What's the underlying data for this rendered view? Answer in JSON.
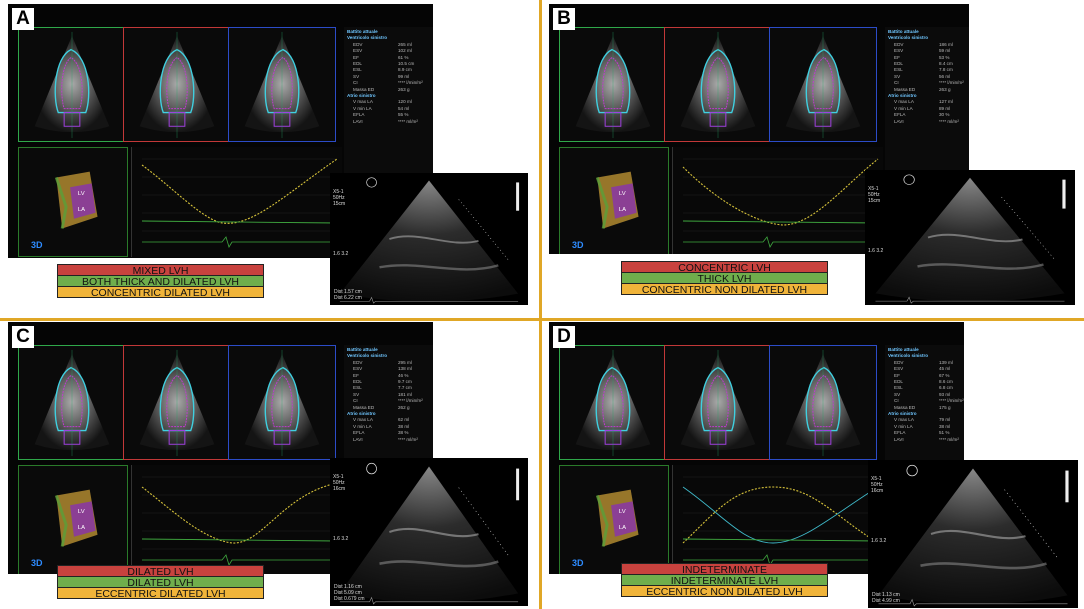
{
  "colors": {
    "divider": "#e0a726",
    "red_label": "#c8423e",
    "green_label": "#6fae4c",
    "yellow_label": "#f0b43a"
  },
  "panels": [
    {
      "letter": "A",
      "labels": [
        "MIXED LVH",
        "BOTH THICK AND DILATED LVH",
        "CONCENTRIC DILATED LVH"
      ],
      "measurements": {
        "header": "Battito attuale",
        "lv_title": "Ventricolo sinistro",
        "lv": [
          [
            "EDV",
            "265 ml"
          ],
          [
            "ESV",
            "102 ml"
          ],
          [
            "EF",
            "61 %"
          ],
          [
            "EDL",
            "10.5 cm"
          ],
          [
            "ESL",
            "8.9 cm"
          ],
          [
            "SV",
            "99 ml"
          ],
          [
            "CI",
            "**** l/min/m²"
          ],
          [
            "Massa ED",
            "263 g"
          ]
        ],
        "la_title": "Atrio sinistro",
        "la": [
          [
            "V max LA",
            "120 ml"
          ],
          [
            "V min LA",
            "54 ml"
          ],
          [
            "EFLA",
            "55 %"
          ],
          [
            "LAVI",
            "**** ml/m²"
          ]
        ]
      },
      "echo": {
        "probe": "X5-1",
        "freq": "50Hz",
        "depth": "15cm",
        "dist1": "Dist 1.57 cm",
        "dist2": "Dist 6.22 cm",
        "scale": "1.6 3.2"
      }
    },
    {
      "letter": "B",
      "labels": [
        "CONCENTRIC LVH",
        "THICK LVH",
        "CONCENTRIC NON DILATED LVH"
      ],
      "measurements": {
        "header": "Battito attuale",
        "lv_title": "Ventricolo sinistro",
        "lv": [
          [
            "EDV",
            "186 ml"
          ],
          [
            "ESV",
            "59 ml"
          ],
          [
            "EF",
            "53 %"
          ],
          [
            "EDL",
            "8.4 cm"
          ],
          [
            "ESL",
            "7.8 cm"
          ],
          [
            "SV",
            "56 ml"
          ],
          [
            "CI",
            "**** l/min/m²"
          ],
          [
            "Massa ED",
            "263 g"
          ]
        ],
        "la_title": "Atrio sinistro",
        "la": [
          [
            "V max LA",
            "127 ml"
          ],
          [
            "V min LA",
            "89 ml"
          ],
          [
            "EFLA",
            "30 %"
          ],
          [
            "LAVI",
            "**** ml/m²"
          ]
        ]
      },
      "echo": {
        "probe": "X5-1",
        "freq": "50Hz",
        "depth": "15cm",
        "dist1": "",
        "dist2": "",
        "scale": "1.6 3.2"
      }
    },
    {
      "letter": "C",
      "labels": [
        "DILATED LVH",
        "DILATED LVH",
        "ECCENTRIC DILATED LVH"
      ],
      "measurements": {
        "header": "Battito attuale",
        "lv_title": "Ventricolo sinistro",
        "lv": [
          [
            "EDV",
            "295 ml"
          ],
          [
            "ESV",
            "138 ml"
          ],
          [
            "EF",
            "46 %"
          ],
          [
            "EDL",
            "9.7 cm"
          ],
          [
            "ESL",
            "7.7 cm"
          ],
          [
            "SV",
            "181 ml"
          ],
          [
            "CI",
            "**** l/min/m²"
          ],
          [
            "Massa ED",
            "262 g"
          ]
        ],
        "la_title": "Atrio sinistro",
        "la": [
          [
            "V max LA",
            "62 ml"
          ],
          [
            "V min LA",
            "38 ml"
          ],
          [
            "EFLA",
            "38 %"
          ],
          [
            "LAVI",
            "**** ml/m²"
          ]
        ]
      },
      "echo": {
        "probe": "X5-1",
        "freq": "50Hz",
        "depth": "16cm",
        "dist1": "Dist 1.16 cm",
        "dist2": "Dist 5.09 cm",
        "dist3": "Dist 0.679 cm",
        "scale": "1.6 3.2"
      }
    },
    {
      "letter": "D",
      "labels": [
        "INDETERMINATE",
        "INDETERMINATE LVH",
        "ECCENTRIC NON DILATED LVH"
      ],
      "measurements": {
        "header": "Battito attuale",
        "lv_title": "Ventricolo sinistro",
        "lv": [
          [
            "EDV",
            "139 ml"
          ],
          [
            "ESV",
            "45 ml"
          ],
          [
            "EF",
            "67 %"
          ],
          [
            "EDL",
            "8.6 cm"
          ],
          [
            "ESL",
            "6.8 cm"
          ],
          [
            "SV",
            "93 ml"
          ],
          [
            "CI",
            "**** l/min/m²"
          ],
          [
            "Massa ED",
            "175 g"
          ]
        ],
        "la_title": "Atrio sinistro",
        "la": [
          [
            "V max LA",
            "79 ml"
          ],
          [
            "V min LA",
            "38 ml"
          ],
          [
            "EFLA",
            "51 %"
          ],
          [
            "LAVI",
            "**** ml/m²"
          ]
        ]
      },
      "echo": {
        "probe": "X5-1",
        "freq": "50Hz",
        "depth": "16cm",
        "dist1": "Dist 1.13 cm",
        "dist2": "Dist 4.99 cm",
        "scale": "1.6 3.2"
      }
    }
  ],
  "label_3d": "3D",
  "view_labels": [
    "LV",
    "LA"
  ]
}
